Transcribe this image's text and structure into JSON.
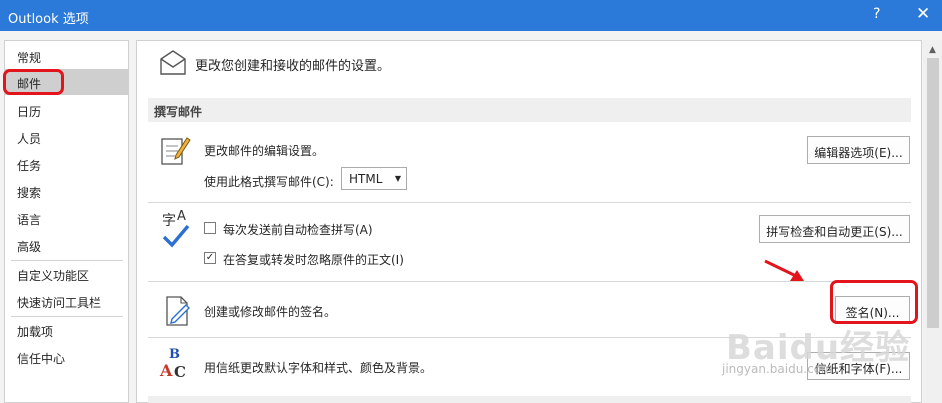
{
  "window": {
    "title": "Outlook 选项",
    "help": "?",
    "close": "✕"
  },
  "sidebar": {
    "items": [
      {
        "label": "常规"
      },
      {
        "label": "邮件"
      },
      {
        "label": "日历"
      },
      {
        "label": "人员"
      },
      {
        "label": "任务"
      },
      {
        "label": "搜索"
      },
      {
        "label": "语言"
      },
      {
        "label": "高级"
      },
      {
        "label": "自定义功能区"
      },
      {
        "label": "快速访问工具栏"
      },
      {
        "label": "加载项"
      },
      {
        "label": "信任中心"
      }
    ],
    "selected": "邮件"
  },
  "main": {
    "header": "更改您创建和接收的邮件的设置。",
    "compose_section": "撰写邮件",
    "edit_settings_text": "更改邮件的编辑设置。",
    "editor_options_button": "编辑器选项(E)...",
    "compose_format_label": "使用此格式撰写邮件(C):",
    "compose_format_value": "HTML",
    "spell_check_text": "每次发送前自动检查拼写(A)",
    "ignore_original_text": "在答复或转发时忽略原件的正文(I)",
    "spelling_button": "拼写检查和自动更正(S)...",
    "signature_text": "创建或修改邮件的签名。",
    "signature_button": "签名(N)...",
    "stationery_text": "用信纸更改默认字体和样式、颜色及背景。",
    "stationery_button": "信纸和字体(F)...",
    "spell_check_checked": false,
    "ignore_original_checked": true
  },
  "watermark": {
    "logo": "Baidu经验",
    "url": "jingyan.baidu.com"
  },
  "colors": {
    "titlebar": "#2b79d8",
    "highlight": "#e3141c"
  }
}
